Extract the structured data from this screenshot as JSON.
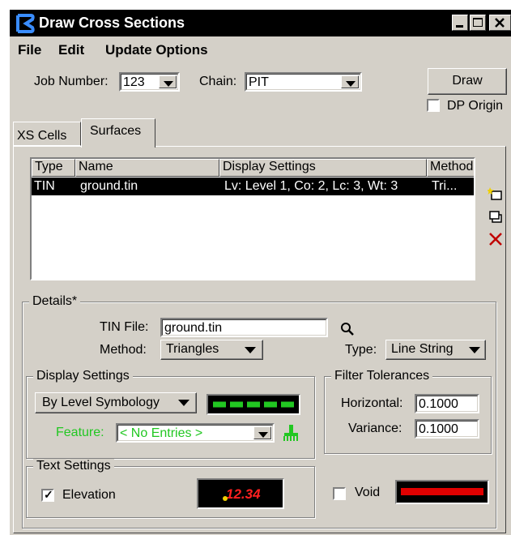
{
  "window": {
    "title": "Draw Cross Sections"
  },
  "menu": {
    "file": "File",
    "edit": "Edit",
    "update_options": "Update Options"
  },
  "toolbar": {
    "job_number_label": "Job Number:",
    "job_number_value": "123",
    "chain_label": "Chain:",
    "chain_value": "PIT",
    "draw_label": "Draw",
    "dp_origin_label": "DP Origin"
  },
  "tabs": [
    {
      "label": "XS Cells"
    },
    {
      "label": "Surfaces"
    }
  ],
  "surfaces_list": {
    "columns": [
      "Type",
      "Name",
      "Display Settings",
      "Method"
    ],
    "rows": [
      [
        "TIN",
        "ground.tin",
        "Lv: Level 1, Co: 2, Lc: 3, Wt: 3",
        "Tri..."
      ]
    ]
  },
  "details": {
    "legend": "Details*",
    "tin_file_label": "TIN File:",
    "tin_file_value": "ground.tin",
    "method_label": "Method:",
    "method_value": "Triangles",
    "type_label": "Type:",
    "type_value": "Line String"
  },
  "display_settings": {
    "legend": "Display Settings",
    "mode_value": "By Level Symbology",
    "feature_label": "Feature:",
    "feature_value": "< No Entries >"
  },
  "filter_tolerances": {
    "legend": "Filter Tolerances",
    "horizontal_label": "Horizontal:",
    "horizontal_value": "0.1000",
    "variance_label": "Variance:",
    "variance_value": "0.1000"
  },
  "text_settings": {
    "legend": "Text Settings",
    "elevation_label": "Elevation",
    "elevation_checked": true,
    "preview_text": "12.34"
  },
  "void": {
    "label": "Void",
    "checked": false
  },
  "colors": {
    "selection": "#000000",
    "feature_green": "#22c722",
    "line_preview_green": "#22c722",
    "void_red": "#e00000",
    "text_preview_red": "#ff2020"
  }
}
